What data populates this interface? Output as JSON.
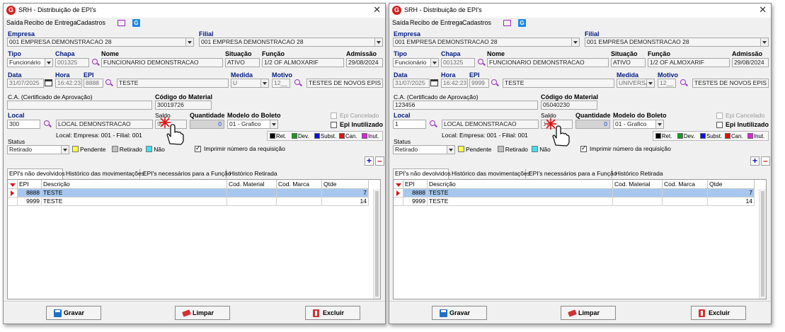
{
  "windows": [
    {
      "id": "left",
      "title": "SRH - Distribuição de EPI's",
      "menu": [
        "Saída",
        "Recibo de Entrega",
        "Cadastros"
      ],
      "labels": {
        "empresa": "Empresa",
        "filial": "Filial",
        "tipo": "Tipo",
        "chapa": "Chapa",
        "nome": "Nome",
        "situacao": "Situação",
        "funcao": "Função",
        "admissao": "Admissão",
        "data": "Data",
        "hora": "Hora",
        "epi": "EPI",
        "medida": "Medida",
        "motivo": "Motivo",
        "ca": "C.A. (Certificado de Aprovação)",
        "codigo_material": "Código do Material",
        "local": "Local",
        "saldo": "Saldo",
        "quantidade": "Quantidade",
        "modelo_boleto": "Modelo do Boleto",
        "epi_cancelado": "Epi Cancelado",
        "epi_inutilizado": "Epi Inutilizado",
        "local_info": "Local:  Empresa: 001  - Filial: 001",
        "status": "Status",
        "imprimir": "Imprimir número da requisição"
      },
      "values": {
        "empresa": "001 EMPRESA DEMONSTRACAO 28",
        "filial": "001 EMPRESA DEMONSTRACAO 28",
        "tipo": "Funcionário",
        "chapa": "001325",
        "nome": "FUNCIONARIO DEMONSTRACAO",
        "situacao": "ATIVO",
        "funcao": "1/2 OF ALMOXARIF",
        "admissao": "29/08/2024",
        "data": "31/07/2025",
        "hora": "16:42:23",
        "epi_code": "8888",
        "epi_desc": "TESTE",
        "medida": "U",
        "motivo_code": "12__",
        "motivo_desc": "TESTES DE NOVOS EPIS",
        "ca": "",
        "codigo_material": "30019726",
        "local_code": "300",
        "local_desc": "LOCAL DEMONSTRACAO",
        "saldo": "90",
        "quantidade": "0",
        "modelo_boleto": "01 - Grafico",
        "status": "Retirado"
      },
      "legend": [
        "Ret.",
        "Dev.",
        "Subst.",
        "Can.",
        "Inut."
      ],
      "status_legend": [
        "Pendente",
        "Retirado",
        "Não"
      ],
      "tabs": [
        "EPI's não devolvidos",
        "Histórico das movimentações",
        "EPI's necessários para a Função",
        "Histórico Retirada"
      ],
      "grid": {
        "headers": [
          "EPI",
          "Descrição",
          "Cod. Material",
          "Cod. Marca",
          "Qtde"
        ],
        "rows": [
          {
            "epi": "8888",
            "desc": "TESTE",
            "mat": "",
            "marca": "",
            "qtde": "7"
          },
          {
            "epi": "9999",
            "desc": "TESTE",
            "mat": "",
            "marca": "",
            "qtde": "14"
          }
        ]
      },
      "buttons": {
        "gravar": "Gravar",
        "limpar": "Limpar",
        "excluir": "Excluir"
      }
    },
    {
      "id": "right",
      "title": "SRH - Distribuição de EPI's",
      "menu": [
        "Saída",
        "Recibo de Entrega",
        "Cadastros"
      ],
      "labels": {
        "empresa": "Empresa",
        "filial": "Filial",
        "tipo": "Tipo",
        "chapa": "Chapa",
        "nome": "Nome",
        "situacao": "Situação",
        "funcao": "Função",
        "admissao": "Admissão",
        "data": "Data",
        "hora": "Hora",
        "epi": "EPI",
        "medida": "Medida",
        "motivo": "Motivo",
        "ca": "C.A. (Certificado de Aprovação)",
        "codigo_material": "Código do Material",
        "local": "Local",
        "saldo": "Saldo",
        "quantidade": "Quantidade",
        "modelo_boleto": "Modelo do Boleto",
        "epi_cancelado": "Epi Cancelado",
        "epi_inutilizado": "Epi Inutilizado",
        "local_info": "Local:  Empresa: 001  - Filial: 001",
        "status": "Status",
        "imprimir": "Imprimir número da requisição"
      },
      "values": {
        "empresa": "001 EMPRESA DEMONSTRACAO 28",
        "filial": "001 EMPRESA DEMONSTRACAO 28",
        "tipo": "Funcionário",
        "chapa": "001325",
        "nome": "FUNCIONARIO DEMONSTRACAO",
        "situacao": "ATIVO",
        "funcao": "1/2 OF ALMOXARIF",
        "admissao": "29/08/2024",
        "data": "31/07/2025",
        "hora": "16:42:23",
        "epi_code": "9999",
        "epi_desc": "TESTE",
        "medida": "UNIVERSA",
        "motivo_code": "12__",
        "motivo_desc": "TESTES DE NOVOS EPIS",
        "ca": "123456",
        "codigo_material": "05040230",
        "local_code": "1",
        "local_desc": "LOCAL DEMONSTRACAO",
        "saldo": "177",
        "quantidade": "0",
        "modelo_boleto": "01 - Grafico",
        "status": "Retirado"
      },
      "legend": [
        "Ret.",
        "Dev.",
        "Subst.",
        "Can.",
        "Inut."
      ],
      "status_legend": [
        "Pendente",
        "Retirado",
        "Não"
      ],
      "tabs": [
        "EPI's não devolvidos",
        "Histórico das movimentações",
        "EPI's necessários para a Função",
        "Histórico Retirada"
      ],
      "grid": {
        "headers": [
          "EPI",
          "Descrição",
          "Cod. Material",
          "Cod. Marca",
          "Qtde"
        ],
        "rows": [
          {
            "epi": "8888",
            "desc": "TESTE",
            "mat": "",
            "marca": "",
            "qtde": "7"
          },
          {
            "epi": "9999",
            "desc": "TESTE",
            "mat": "",
            "marca": "",
            "qtde": "14"
          }
        ]
      },
      "buttons": {
        "gravar": "Gravar",
        "limpar": "Limpar",
        "excluir": "Excluir"
      }
    }
  ],
  "colors": {
    "label_blue": "#001a80",
    "selected_row": "#a7c7ee",
    "legend": [
      "#000000",
      "#1a9a1a",
      "#1010e0",
      "#e01010",
      "#e020e0"
    ],
    "status_legend": [
      "#ffff40",
      "#c0c0c0",
      "#40e0f0"
    ],
    "icon_purple": "#9b30c0"
  },
  "icons": [
    "app-logo-icon",
    "chat-icon",
    "g-icon",
    "search-icon",
    "calendar-icon",
    "plus-icon",
    "minus-icon",
    "save-icon",
    "eraser-icon",
    "trash-icon",
    "hand-cursor-icon",
    "close-icon"
  ]
}
